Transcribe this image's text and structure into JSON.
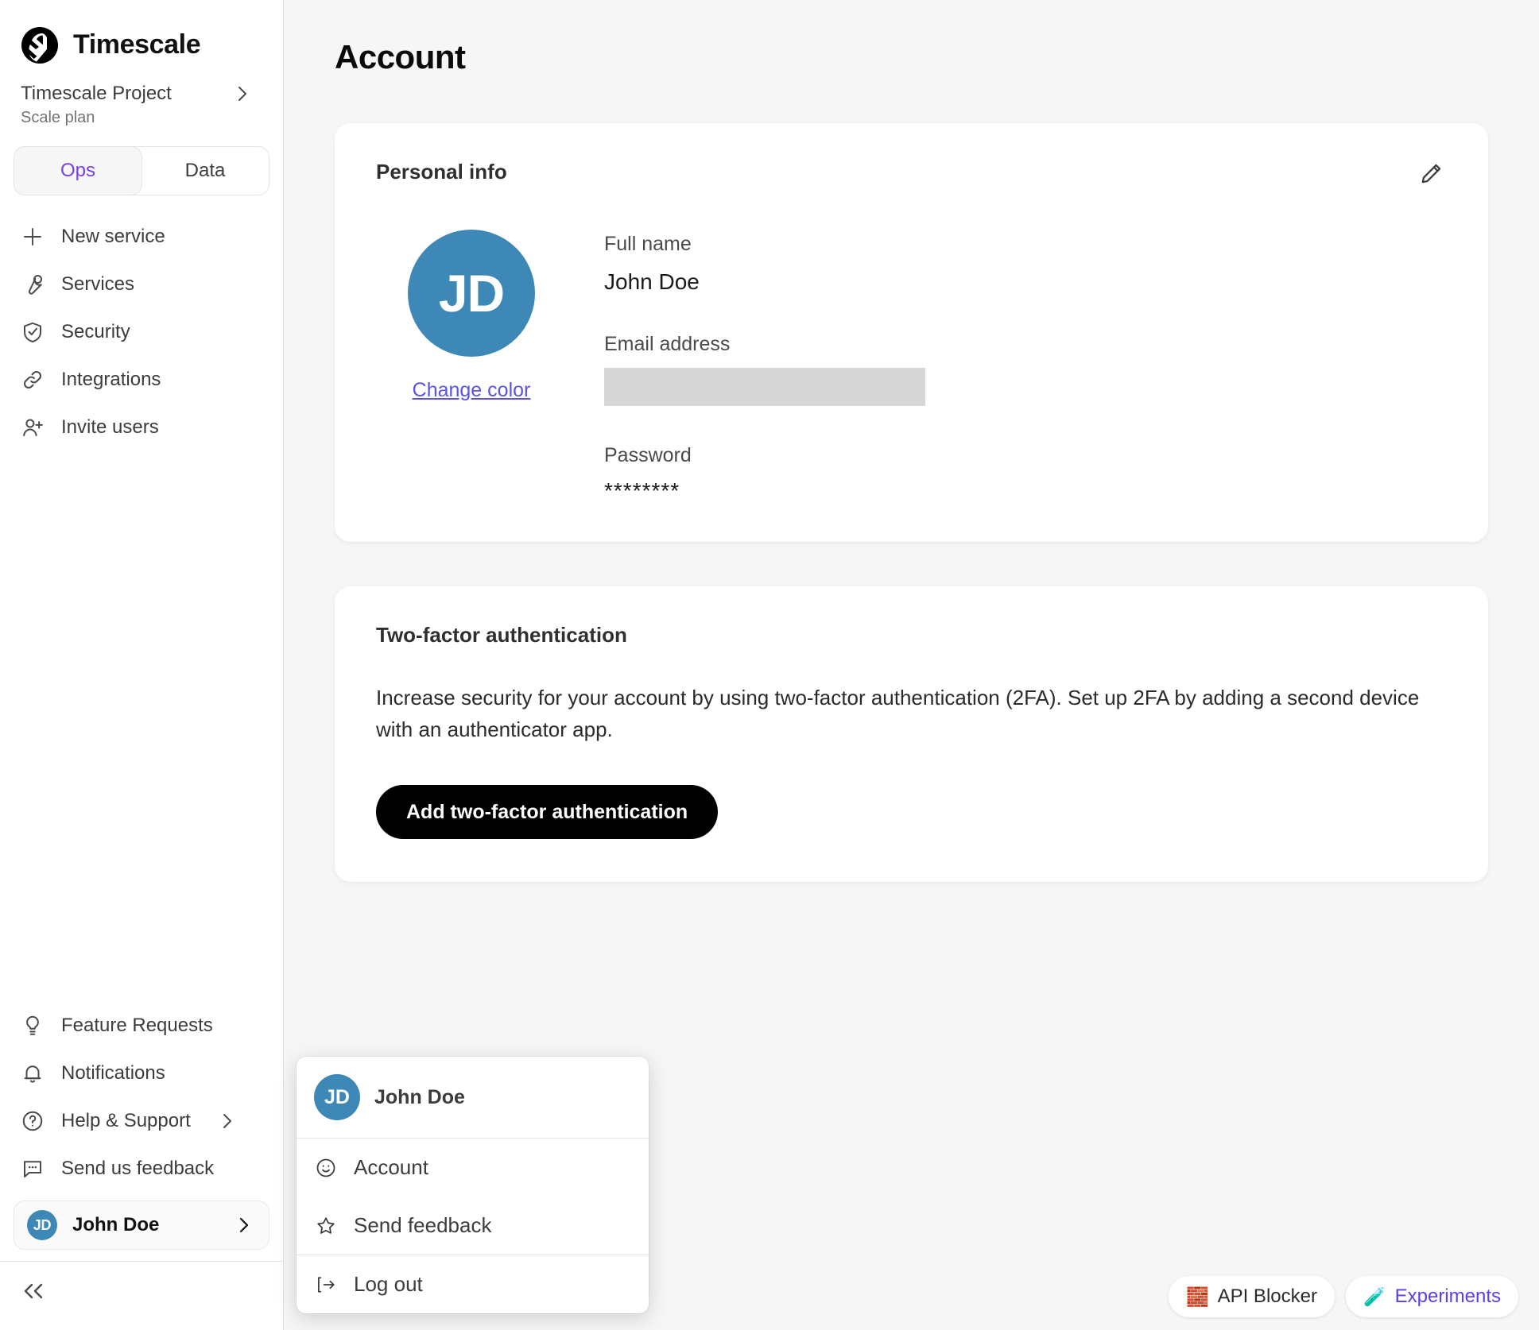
{
  "brand": {
    "name": "Timescale",
    "logo_icon": "timescale-logo-icon"
  },
  "project": {
    "name": "Timescale Project",
    "plan": "Scale plan",
    "chevron_icon": "chevron-right-icon"
  },
  "segmented": {
    "tabs": [
      {
        "label": "Ops",
        "active": true
      },
      {
        "label": "Data",
        "active": false
      }
    ],
    "active_color": "#7B3FE4"
  },
  "nav": {
    "primary": [
      {
        "label": "New service",
        "icon": "plus-icon"
      },
      {
        "label": "Services",
        "icon": "wrench-icon"
      },
      {
        "label": "Security",
        "icon": "shield-check-icon"
      },
      {
        "label": "Integrations",
        "icon": "link-icon"
      },
      {
        "label": "Invite users",
        "icon": "user-plus-icon"
      }
    ],
    "secondary": [
      {
        "label": "Feature Requests",
        "icon": "lightbulb-icon",
        "chevron": false
      },
      {
        "label": "Notifications",
        "icon": "bell-icon",
        "chevron": false
      },
      {
        "label": "Help & Support",
        "icon": "question-circle-icon",
        "chevron": true
      },
      {
        "label": "Send us feedback",
        "icon": "chat-bubble-icon",
        "chevron": false
      }
    ]
  },
  "user_button": {
    "initials": "JD",
    "name": "John Doe",
    "chevron_icon": "chevron-right-icon",
    "avatar_color": "#3E88B8"
  },
  "collapse": {
    "label": "<<",
    "icon": "chevrons-left-icon"
  },
  "page": {
    "title": "Account"
  },
  "personal_info": {
    "title": "Personal info",
    "edit_icon": "pencil-icon",
    "avatar_initials": "JD",
    "avatar_color": "#3E88B8",
    "change_color_label": "Change color",
    "change_color_link_color": "#5B52E8",
    "fields": [
      {
        "label": "Full name",
        "value": "John Doe",
        "redacted": false
      },
      {
        "label": "Email address",
        "value": "",
        "redacted": true
      },
      {
        "label": "Password",
        "value": "********",
        "redacted": false
      }
    ]
  },
  "two_factor": {
    "title": "Two-factor authentication",
    "description": "Increase security for your account by using two-factor authentication (2FA). Set up 2FA by adding a second device with an authenticator app.",
    "button_label": "Add two-factor authentication"
  },
  "user_popup": {
    "initials": "JD",
    "name": "John Doe",
    "email_redacted": true,
    "items": [
      {
        "label": "Account",
        "icon": "smiley-face-icon"
      },
      {
        "label": "Send feedback",
        "icon": "star-icon"
      },
      {
        "label": "Log out",
        "icon": "logout-arrow-icon"
      }
    ]
  },
  "badges": [
    {
      "label": "API Blocker",
      "emoji": "🧱",
      "icon": "brick-icon",
      "color": "#2B2B2B"
    },
    {
      "label": "Experiments",
      "emoji": "🧪",
      "icon": "test-tube-icon",
      "color": "#5B3FE8"
    }
  ]
}
